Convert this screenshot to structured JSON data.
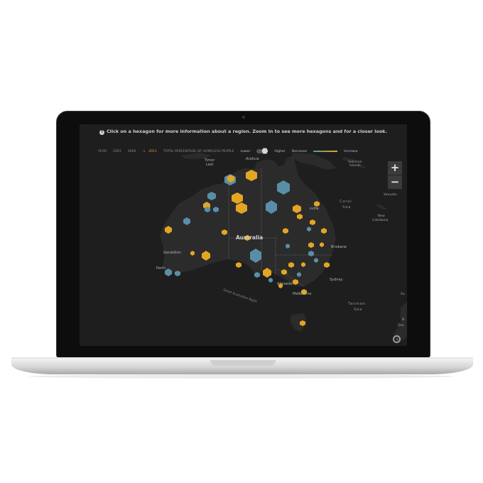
{
  "instruction": "Click on a hexagon for more information about a region. Zoom in to see more hexagons and for a closer look.",
  "legend": {
    "year_label": "YEAR",
    "years": [
      "2001",
      "2006",
      "2011"
    ],
    "active_year": "2011",
    "arrow": "→",
    "metric_label": "TOTAL PERCENTAGE OF HOMELESS PEOPLE",
    "lower": "Lower",
    "higher": "Higher",
    "decrease": "Decrease",
    "increase": "Increase"
  },
  "zoom": {
    "plus": "+",
    "minus": "−"
  },
  "map_labels": {
    "country": "Australia",
    "geraldton": "Geraldton",
    "perth": "Perth",
    "brisbane": "Brisbane",
    "adelaide": "Adelaide",
    "melbourne": "Melbourne",
    "sydney": "Sydney",
    "townsville": "sville",
    "coral_sea_1": "Coral",
    "coral_sea_2": "Sea",
    "tasman_1": "Tasman",
    "tasman_2": "Sea",
    "solomon_1": "Solomon",
    "solomon_2": "Islands",
    "vanuatu": "Vanuatu",
    "new_cal_1": "New",
    "new_cal_2": "Caledonia",
    "bight": "Great Australian Bight",
    "timor_1": "Timor",
    "timor_2": "Lest",
    "arafura": "Arafura",
    "aus_right": "Au",
    "zea_1": "N",
    "zea_2": "Zea"
  },
  "colors": {
    "increase": "#e3a623",
    "decrease": "#5a8ea8",
    "land": "#2b2b2b",
    "ocean": "#1e1e1e"
  }
}
